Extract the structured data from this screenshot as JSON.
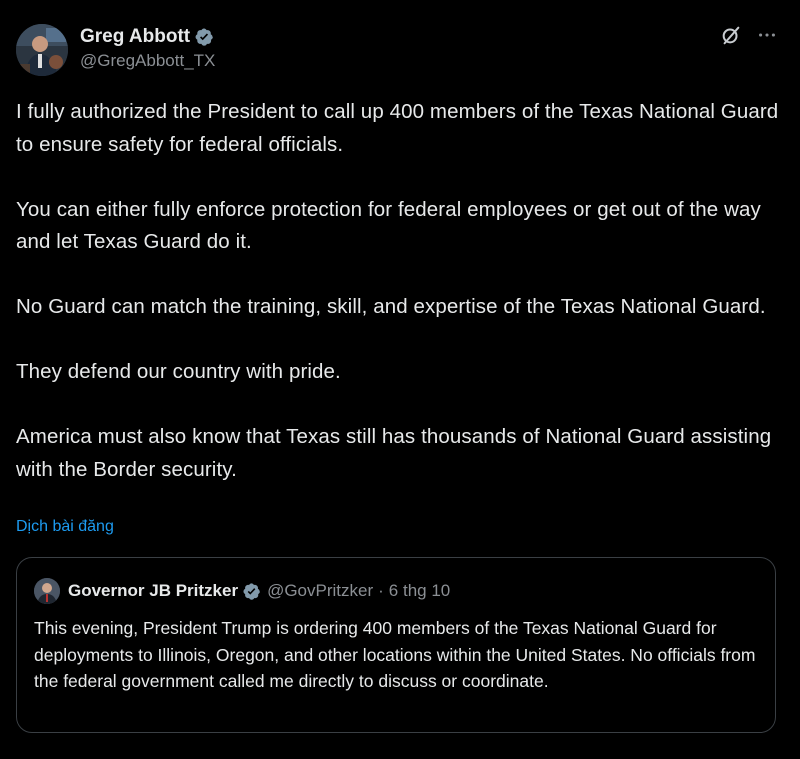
{
  "tweet": {
    "author": {
      "display_name": "Greg Abbott",
      "handle": "@GregAbbott_TX",
      "avatar": "person-photo"
    },
    "icons": {
      "verified": "verified-badge-icon",
      "grok": "grok-icon",
      "more": "more-options-icon"
    },
    "paragraphs": [
      "I fully authorized the President to call up 400 members of the Texas National Guard to ensure safety for federal officials.",
      "You can either fully enforce protection for federal employees or get out of the way and let Texas Guard do it.",
      "No Guard can match the training, skill, and expertise of the Texas National Guard.",
      "They defend our country with pride.",
      "America must also know that Texas still has thousands of National Guard assisting with the Border security."
    ],
    "translate_label": "Dịch bài đăng"
  },
  "quote": {
    "display_name": "Governor JB Pritzker",
    "handle": "@GovPritzker",
    "separator": "·",
    "date": "6 thg 10",
    "text": "This evening, President Trump is ordering 400 members of the Texas National Guard for deployments to Illinois, Oregon, and other locations within the United States. No officials from the federal government called me directly to discuss or coordinate."
  },
  "colors": {
    "background": "#000000",
    "text": "#e7e9ea",
    "muted": "#8b8f94",
    "link": "#1d9bf0",
    "verified": "#829aab",
    "border": "#3a3f44"
  }
}
